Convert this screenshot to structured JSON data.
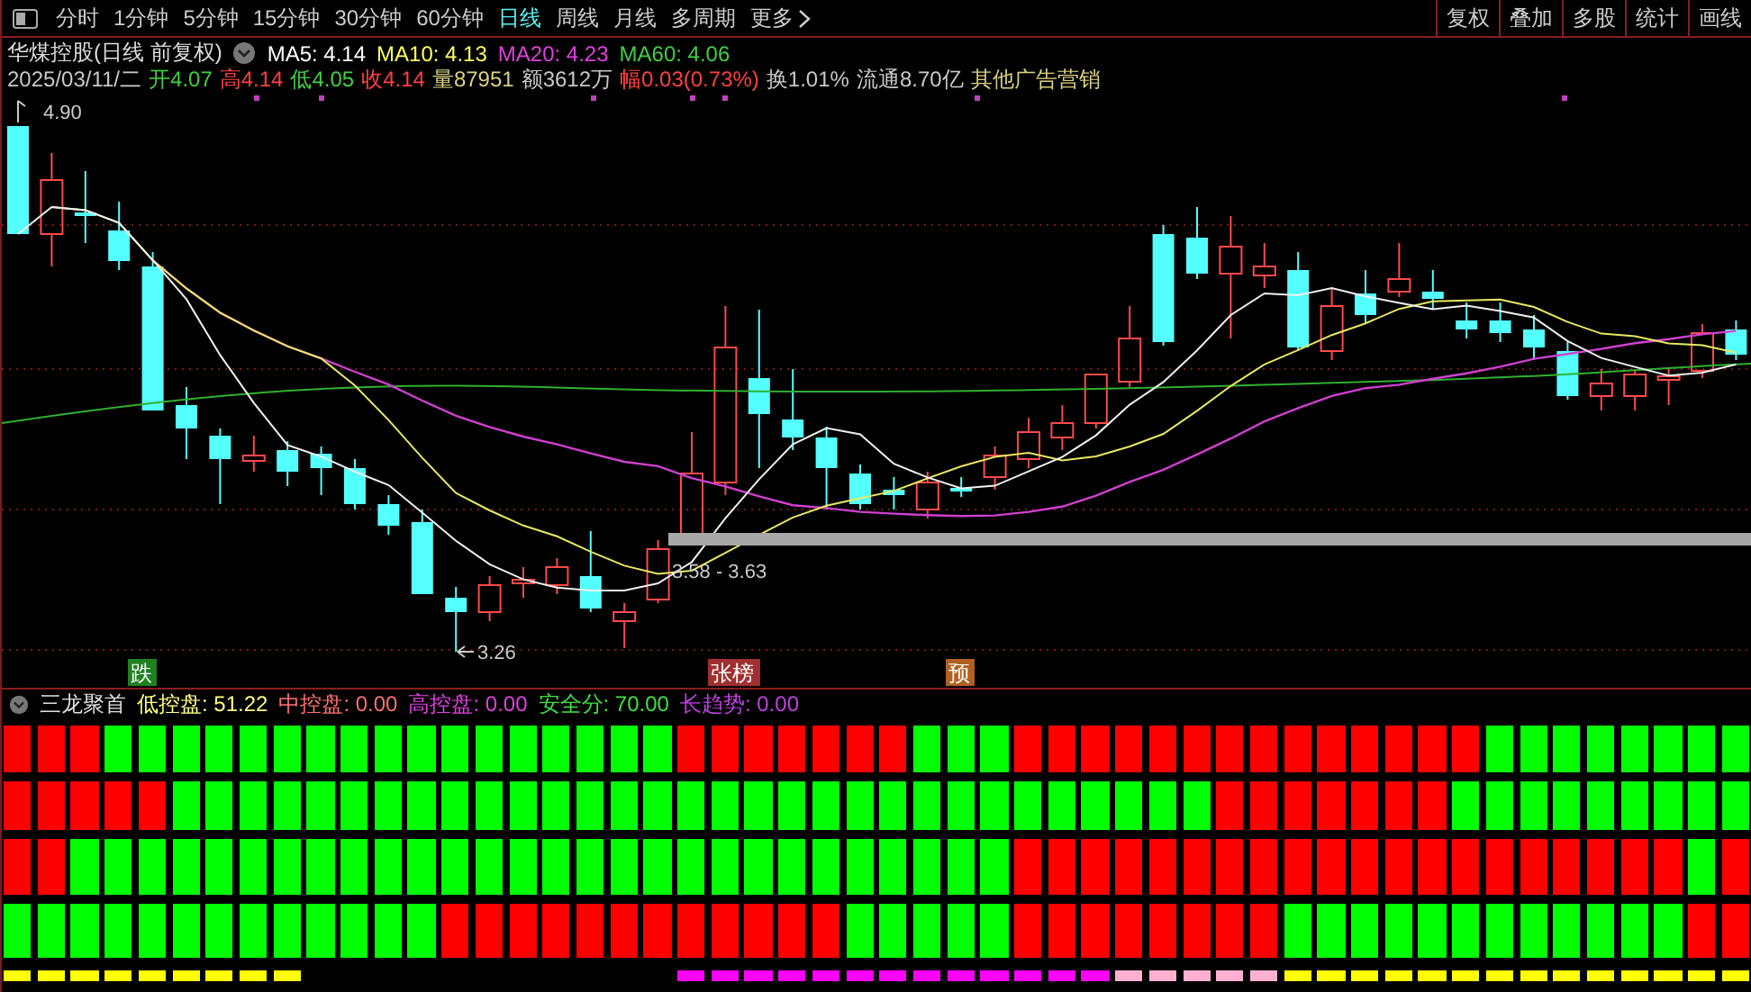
{
  "toolbar": {
    "periods": [
      {
        "label": "分时",
        "selected": false
      },
      {
        "label": "1分钟",
        "selected": false
      },
      {
        "label": "5分钟",
        "selected": false
      },
      {
        "label": "15分钟",
        "selected": false
      },
      {
        "label": "30分钟",
        "selected": false
      },
      {
        "label": "60分钟",
        "selected": false
      },
      {
        "label": "日线",
        "selected": true
      },
      {
        "label": "周线",
        "selected": false
      },
      {
        "label": "月线",
        "selected": false
      },
      {
        "label": "多周期",
        "selected": false
      }
    ],
    "more": "更多",
    "tools": [
      "复权",
      "叠加",
      "多股",
      "统计",
      "画线"
    ]
  },
  "info": {
    "title": "华煤控股(日线 前复权)",
    "ma": [
      {
        "text": "MA5: 4.14",
        "color": "#ffffff"
      },
      {
        "text": "MA10: 4.13",
        "color": "#ffff60"
      },
      {
        "text": "MA20: 4.23",
        "color": "#e040e0"
      },
      {
        "text": "MA60: 4.06",
        "color": "#40d040"
      }
    ]
  },
  "quote": [
    {
      "text": "2025/03/11/二",
      "color": "#c8c8c8"
    },
    {
      "text": "开4.07",
      "color": "#40d040"
    },
    {
      "text": "高4.14",
      "color": "#ff4040"
    },
    {
      "text": "低4.05",
      "color": "#40d040"
    },
    {
      "text": "收4.14",
      "color": "#ff4040"
    },
    {
      "text": "量87951",
      "color": "#d8d080"
    },
    {
      "text": "额3612万",
      "color": "#c8c8c8"
    },
    {
      "text": "幅0.03(0.73%)",
      "color": "#ff4040"
    },
    {
      "text": "换1.01%",
      "color": "#c8c8c8"
    },
    {
      "text": "流通8.70亿",
      "color": "#c8c8c8"
    },
    {
      "text": "其他广告营销",
      "color": "#d8d080"
    }
  ],
  "chart": {
    "high_label": "4.90",
    "low_label": "3.26",
    "band_label": "3.58 - 3.63",
    "tags": [
      {
        "text": "跌",
        "color": "#208020"
      },
      {
        "text": "张榜",
        "color": "#a03030"
      },
      {
        "text": "预",
        "color": "#b06020"
      }
    ]
  },
  "indicator": {
    "name": "三龙聚首",
    "values": [
      {
        "text": "低控盘: 51.22",
        "color": "#ffff80"
      },
      {
        "text": "中控盘: 0.00",
        "color": "#ff7070"
      },
      {
        "text": "高控盘: 0.00",
        "color": "#e040e0"
      },
      {
        "text": "安全分: 70.00",
        "color": "#40e040"
      },
      {
        "text": "长趋势: 0.00",
        "color": "#c040e0"
      }
    ]
  },
  "heat_rows": [
    {
      "cells": [
        {
          "color": "#ff0000"
        },
        {
          "color": "#ff0000"
        },
        {
          "color": "#ff0000"
        },
        {
          "color": "#00ff00"
        },
        {
          "color": "#00ff00"
        },
        {
          "color": "#00ff00"
        },
        {
          "color": "#00ff00"
        },
        {
          "color": "#00ff00"
        },
        {
          "color": "#00ff00"
        },
        {
          "color": "#00ff00"
        },
        {
          "color": "#00ff00"
        },
        {
          "color": "#00ff00"
        },
        {
          "color": "#00ff00"
        },
        {
          "color": "#00ff00"
        },
        {
          "color": "#00ff00"
        },
        {
          "color": "#00ff00"
        },
        {
          "color": "#00ff00"
        },
        {
          "color": "#00ff00"
        },
        {
          "color": "#00ff00"
        },
        {
          "color": "#00ff00"
        },
        {
          "color": "#ff0000"
        },
        {
          "color": "#ff0000"
        },
        {
          "color": "#ff0000"
        },
        {
          "color": "#ff0000"
        },
        {
          "color": "#ff0000"
        },
        {
          "color": "#ff0000"
        },
        {
          "color": "#ff0000"
        },
        {
          "color": "#00ff00"
        },
        {
          "color": "#00ff00"
        },
        {
          "color": "#00ff00"
        },
        {
          "color": "#ff0000"
        },
        {
          "color": "#ff0000"
        },
        {
          "color": "#ff0000"
        },
        {
          "color": "#ff0000"
        },
        {
          "color": "#ff0000"
        },
        {
          "color": "#ff0000"
        },
        {
          "color": "#ff0000"
        },
        {
          "color": "#ff0000"
        },
        {
          "color": "#ff0000"
        },
        {
          "color": "#ff0000"
        },
        {
          "color": "#ff0000"
        },
        {
          "color": "#ff0000"
        },
        {
          "color": "#ff0000"
        },
        {
          "color": "#ff0000"
        },
        {
          "color": "#00ff00"
        },
        {
          "color": "#00ff00"
        },
        {
          "color": "#00ff00"
        },
        {
          "color": "#00ff00"
        },
        {
          "color": "#00ff00"
        },
        {
          "color": "#00ff00"
        },
        {
          "color": "#00ff00"
        },
        {
          "color": "#00ff00"
        }
      ]
    },
    {
      "cells": [
        {
          "color": "#ff0000"
        },
        {
          "color": "#ff0000"
        },
        {
          "color": "#ff0000"
        },
        {
          "color": "#ff0000"
        },
        {
          "color": "#ff0000"
        },
        {
          "color": "#00ff00"
        },
        {
          "color": "#00ff00"
        },
        {
          "color": "#00ff00"
        },
        {
          "color": "#00ff00"
        },
        {
          "color": "#00ff00"
        },
        {
          "color": "#00ff00"
        },
        {
          "color": "#00ff00"
        },
        {
          "color": "#00ff00"
        },
        {
          "color": "#00ff00"
        },
        {
          "color": "#00ff00"
        },
        {
          "color": "#00ff00"
        },
        {
          "color": "#00ff00"
        },
        {
          "color": "#00ff00"
        },
        {
          "color": "#00ff00"
        },
        {
          "color": "#00ff00"
        },
        {
          "color": "#00ff00"
        },
        {
          "color": "#00ff00"
        },
        {
          "color": "#00ff00"
        },
        {
          "color": "#00ff00"
        },
        {
          "color": "#00ff00"
        },
        {
          "color": "#00ff00"
        },
        {
          "color": "#00ff00"
        },
        {
          "color": "#00ff00"
        },
        {
          "color": "#00ff00"
        },
        {
          "color": "#00ff00"
        },
        {
          "color": "#00ff00"
        },
        {
          "color": "#00ff00"
        },
        {
          "color": "#00ff00"
        },
        {
          "color": "#00ff00"
        },
        {
          "color": "#00ff00"
        },
        {
          "color": "#00ff00"
        },
        {
          "color": "#ff0000"
        },
        {
          "color": "#ff0000"
        },
        {
          "color": "#ff0000"
        },
        {
          "color": "#ff0000"
        },
        {
          "color": "#ff0000"
        },
        {
          "color": "#ff0000"
        },
        {
          "color": "#ff0000"
        },
        {
          "color": "#00ff00"
        },
        {
          "color": "#00ff00"
        },
        {
          "color": "#00ff00"
        },
        {
          "color": "#00ff00"
        },
        {
          "color": "#00ff00"
        },
        {
          "color": "#00ff00"
        },
        {
          "color": "#00ff00"
        },
        {
          "color": "#00ff00"
        },
        {
          "color": "#00ff00"
        }
      ]
    },
    {
      "cells": [
        {
          "color": "#ff0000"
        },
        {
          "color": "#ff0000"
        },
        {
          "color": "#00ff00"
        },
        {
          "color": "#00ff00"
        },
        {
          "color": "#00ff00"
        },
        {
          "color": "#00ff00"
        },
        {
          "color": "#00ff00"
        },
        {
          "color": "#00ff00"
        },
        {
          "color": "#00ff00"
        },
        {
          "color": "#00ff00"
        },
        {
          "color": "#00ff00"
        },
        {
          "color": "#00ff00"
        },
        {
          "color": "#00ff00"
        },
        {
          "color": "#00ff00"
        },
        {
          "color": "#00ff00"
        },
        {
          "color": "#00ff00"
        },
        {
          "color": "#00ff00"
        },
        {
          "color": "#00ff00"
        },
        {
          "color": "#00ff00"
        },
        {
          "color": "#00ff00"
        },
        {
          "color": "#00ff00"
        },
        {
          "color": "#00ff00"
        },
        {
          "color": "#00ff00"
        },
        {
          "color": "#00ff00"
        },
        {
          "color": "#00ff00"
        },
        {
          "color": "#00ff00"
        },
        {
          "color": "#00ff00"
        },
        {
          "color": "#00ff00"
        },
        {
          "color": "#00ff00"
        },
        {
          "color": "#00ff00"
        },
        {
          "color": "#ff0000"
        },
        {
          "color": "#ff0000"
        },
        {
          "color": "#ff0000"
        },
        {
          "color": "#ff0000"
        },
        {
          "color": "#ff0000"
        },
        {
          "color": "#ff0000"
        },
        {
          "color": "#ff0000"
        },
        {
          "color": "#ff0000"
        },
        {
          "color": "#ff0000"
        },
        {
          "color": "#ff0000"
        },
        {
          "color": "#ff0000"
        },
        {
          "color": "#ff0000"
        },
        {
          "color": "#ff0000"
        },
        {
          "color": "#ff0000"
        },
        {
          "color": "#ff0000"
        },
        {
          "color": "#ff0000"
        },
        {
          "color": "#ff0000"
        },
        {
          "color": "#ff0000"
        },
        {
          "color": "#ff0000"
        },
        {
          "color": "#ff0000"
        },
        {
          "color": "#00ff00"
        },
        {
          "color": "#ff0000"
        }
      ]
    },
    {
      "cells": [
        {
          "color": "#00ff00"
        },
        {
          "color": "#00ff00"
        },
        {
          "color": "#00ff00"
        },
        {
          "color": "#00ff00"
        },
        {
          "color": "#00ff00"
        },
        {
          "color": "#00ff00"
        },
        {
          "color": "#00ff00"
        },
        {
          "color": "#00ff00"
        },
        {
          "color": "#00ff00"
        },
        {
          "color": "#00ff00"
        },
        {
          "color": "#00ff00"
        },
        {
          "color": "#00ff00"
        },
        {
          "color": "#00ff00"
        },
        {
          "color": "#ff0000"
        },
        {
          "color": "#ff0000"
        },
        {
          "color": "#ff0000"
        },
        {
          "color": "#ff0000"
        },
        {
          "color": "#ff0000"
        },
        {
          "color": "#ff0000"
        },
        {
          "color": "#ff0000"
        },
        {
          "color": "#ff0000"
        },
        {
          "color": "#ff0000"
        },
        {
          "color": "#ff0000"
        },
        {
          "color": "#ff0000"
        },
        {
          "color": "#ff0000"
        },
        {
          "color": "#00ff00"
        },
        {
          "color": "#00ff00"
        },
        {
          "color": "#00ff00"
        },
        {
          "color": "#00ff00"
        },
        {
          "color": "#00ff00"
        },
        {
          "color": "#ff0000"
        },
        {
          "color": "#ff0000"
        },
        {
          "color": "#ff0000"
        },
        {
          "color": "#ff0000"
        },
        {
          "color": "#ff0000"
        },
        {
          "color": "#ff0000"
        },
        {
          "color": "#ff0000"
        },
        {
          "color": "#ff0000"
        },
        {
          "color": "#00ff00"
        },
        {
          "color": "#00ff00"
        },
        {
          "color": "#00ff00"
        },
        {
          "color": "#00ff00"
        },
        {
          "color": "#00ff00"
        },
        {
          "color": "#00ff00"
        },
        {
          "color": "#00ff00"
        },
        {
          "color": "#00ff00"
        },
        {
          "color": "#00ff00"
        },
        {
          "color": "#00ff00"
        },
        {
          "color": "#00ff00"
        },
        {
          "color": "#00ff00"
        },
        {
          "color": "#ff0000"
        },
        {
          "color": "#ff0000"
        }
      ]
    }
  ],
  "marker_row": [
    {
      "kind": "mark",
      "color": "#ffff00"
    },
    {
      "kind": "mark",
      "color": "#ffff00"
    },
    {
      "kind": "mark",
      "color": "#ffff00"
    },
    {
      "kind": "mark",
      "color": "#ffff00"
    },
    {
      "kind": "mark",
      "color": "#ffff00"
    },
    {
      "kind": "mark",
      "color": "#ffff00"
    },
    {
      "kind": "mark",
      "color": "#ffff00"
    },
    {
      "kind": "mark",
      "color": "#ffff00"
    },
    {
      "kind": "mark",
      "color": "#ffff00"
    },
    {
      "kind": "gap"
    },
    {
      "kind": "gap"
    },
    {
      "kind": "gap"
    },
    {
      "kind": "gap"
    },
    {
      "kind": "gap"
    },
    {
      "kind": "gap"
    },
    {
      "kind": "gap"
    },
    {
      "kind": "gap"
    },
    {
      "kind": "gap"
    },
    {
      "kind": "gap"
    },
    {
      "kind": "gap"
    },
    {
      "kind": "mark",
      "color": "#ff00ff"
    },
    {
      "kind": "mark",
      "color": "#ff00ff"
    },
    {
      "kind": "mark",
      "color": "#ff00ff"
    },
    {
      "kind": "mark",
      "color": "#ff00ff"
    },
    {
      "kind": "mark",
      "color": "#ff00ff"
    },
    {
      "kind": "mark",
      "color": "#ff00ff"
    },
    {
      "kind": "mark",
      "color": "#ff00ff"
    },
    {
      "kind": "mark",
      "color": "#ff00ff"
    },
    {
      "kind": "mark",
      "color": "#ff00ff"
    },
    {
      "kind": "mark",
      "color": "#ff00ff"
    },
    {
      "kind": "mark",
      "color": "#ff00ff"
    },
    {
      "kind": "mark",
      "color": "#ff00ff"
    },
    {
      "kind": "mark",
      "color": "#ff00ff"
    },
    {
      "kind": "mark",
      "color": "#ffb0d0"
    },
    {
      "kind": "mark",
      "color": "#ffb0d0"
    },
    {
      "kind": "mark",
      "color": "#ffb0d0"
    },
    {
      "kind": "mark",
      "color": "#ffb0d0"
    },
    {
      "kind": "mark",
      "color": "#ffb0d0"
    },
    {
      "kind": "mark",
      "color": "#ffff00"
    },
    {
      "kind": "mark",
      "color": "#ffff00"
    },
    {
      "kind": "mark",
      "color": "#ffff00"
    },
    {
      "kind": "mark",
      "color": "#ffff00"
    },
    {
      "kind": "mark",
      "color": "#ffff00"
    },
    {
      "kind": "mark",
      "color": "#ffff00"
    },
    {
      "kind": "mark",
      "color": "#ffff00"
    },
    {
      "kind": "mark",
      "color": "#ffff00"
    },
    {
      "kind": "mark",
      "color": "#ffff00"
    },
    {
      "kind": "mark",
      "color": "#ffff00"
    },
    {
      "kind": "mark",
      "color": "#ffff00"
    },
    {
      "kind": "mark",
      "color": "#ffff00"
    },
    {
      "kind": "mark",
      "color": "#ffff00"
    },
    {
      "kind": "mark",
      "color": "#ffff00"
    }
  ]
}
